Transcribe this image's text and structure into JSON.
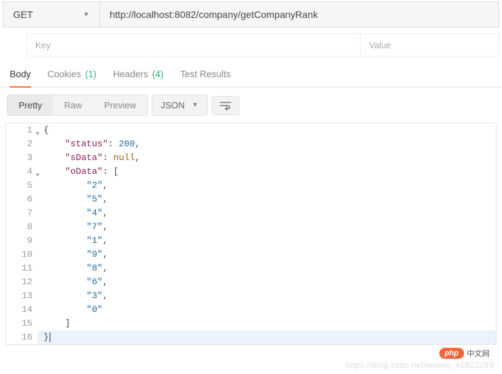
{
  "request": {
    "method": "GET",
    "url": "http://localhost:8082/company/getCompanyRank"
  },
  "params": {
    "key_placeholder": "Key",
    "value_placeholder": "Value"
  },
  "tabs": {
    "body": "Body",
    "cookies": "Cookies",
    "cookies_count": "(1)",
    "headers": "Headers",
    "headers_count": "(4)",
    "test_results": "Test Results"
  },
  "format": {
    "pretty": "Pretty",
    "raw": "Raw",
    "preview": "Preview",
    "json": "JSON"
  },
  "code_lines": [
    {
      "n": 1,
      "fold": true,
      "indent": 0,
      "tokens": [
        [
          "punct",
          "{"
        ]
      ]
    },
    {
      "n": 2,
      "fold": false,
      "indent": 1,
      "tokens": [
        [
          "key",
          "\"status\""
        ],
        [
          "punct",
          ": "
        ],
        [
          "num",
          "200"
        ],
        [
          "punct",
          ","
        ]
      ]
    },
    {
      "n": 3,
      "fold": false,
      "indent": 1,
      "tokens": [
        [
          "key",
          "\"sData\""
        ],
        [
          "punct",
          ": "
        ],
        [
          "null",
          "null"
        ],
        [
          "punct",
          ","
        ]
      ]
    },
    {
      "n": 4,
      "fold": true,
      "indent": 1,
      "tokens": [
        [
          "key",
          "\"oData\""
        ],
        [
          "punct",
          ": ["
        ]
      ]
    },
    {
      "n": 5,
      "fold": false,
      "indent": 2,
      "tokens": [
        [
          "str",
          "\"2\""
        ],
        [
          "punct",
          ","
        ]
      ]
    },
    {
      "n": 6,
      "fold": false,
      "indent": 2,
      "tokens": [
        [
          "str",
          "\"5\""
        ],
        [
          "punct",
          ","
        ]
      ]
    },
    {
      "n": 7,
      "fold": false,
      "indent": 2,
      "tokens": [
        [
          "str",
          "\"4\""
        ],
        [
          "punct",
          ","
        ]
      ]
    },
    {
      "n": 8,
      "fold": false,
      "indent": 2,
      "tokens": [
        [
          "str",
          "\"7\""
        ],
        [
          "punct",
          ","
        ]
      ]
    },
    {
      "n": 9,
      "fold": false,
      "indent": 2,
      "tokens": [
        [
          "str",
          "\"1\""
        ],
        [
          "punct",
          ","
        ]
      ]
    },
    {
      "n": 10,
      "fold": false,
      "indent": 2,
      "tokens": [
        [
          "str",
          "\"9\""
        ],
        [
          "punct",
          ","
        ]
      ]
    },
    {
      "n": 11,
      "fold": false,
      "indent": 2,
      "tokens": [
        [
          "str",
          "\"8\""
        ],
        [
          "punct",
          ","
        ]
      ]
    },
    {
      "n": 12,
      "fold": false,
      "indent": 2,
      "tokens": [
        [
          "str",
          "\"6\""
        ],
        [
          "punct",
          ","
        ]
      ]
    },
    {
      "n": 13,
      "fold": false,
      "indent": 2,
      "tokens": [
        [
          "str",
          "\"3\""
        ],
        [
          "punct",
          ","
        ]
      ]
    },
    {
      "n": 14,
      "fold": false,
      "indent": 2,
      "tokens": [
        [
          "str",
          "\"0\""
        ]
      ]
    },
    {
      "n": 15,
      "fold": false,
      "indent": 1,
      "tokens": [
        [
          "punct",
          "]"
        ]
      ]
    },
    {
      "n": 16,
      "fold": false,
      "indent": 0,
      "tokens": [
        [
          "punct",
          "}"
        ]
      ],
      "hl": true,
      "cursor": true
    }
  ],
  "watermark": {
    "blog": "https://blog.csdn.net/weixin_41922289",
    "php": "php",
    "cn": "中文网"
  }
}
